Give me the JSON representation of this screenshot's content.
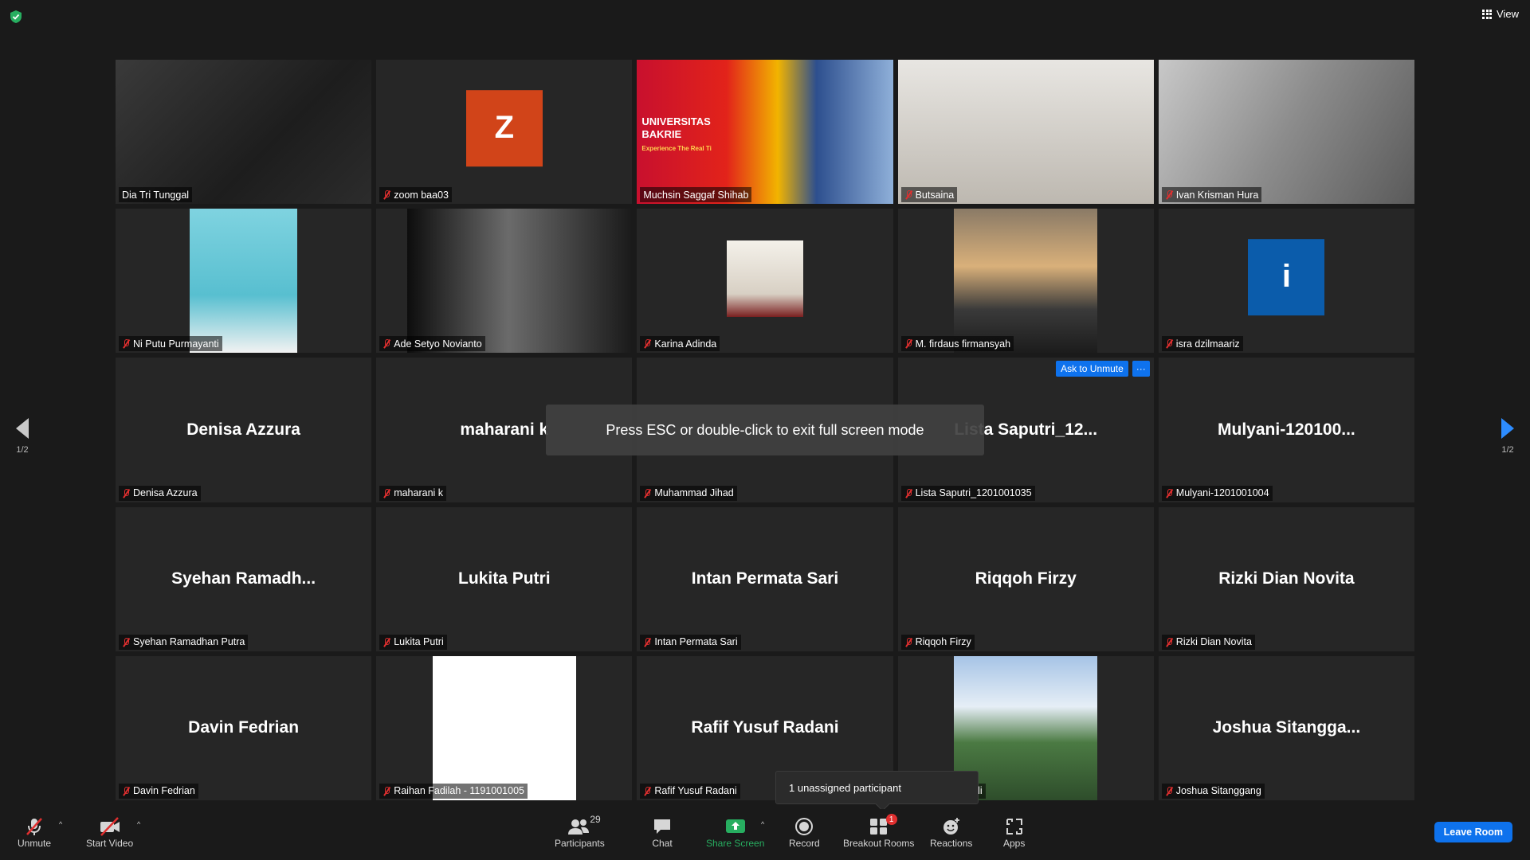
{
  "top_bar": {
    "view_label": "View"
  },
  "toast": {
    "message": "Press ESC or double-click to exit full screen mode"
  },
  "pagination": {
    "left_page": "1/2",
    "right_page": "1/2"
  },
  "ask_to_unmute": {
    "label": "Ask to Unmute",
    "more": "···"
  },
  "popup": {
    "text": "1 unassigned participant"
  },
  "tiles": [
    {
      "label": "Dia Tri Tunggal",
      "display_name": "",
      "video": "video-dark",
      "muted": false,
      "active": true
    },
    {
      "label": "zoom baa03",
      "display_name": "",
      "avatar": "Z",
      "avatar_color": "#d14419",
      "muted": true
    },
    {
      "label": "Muchsin Saggaf Shihab",
      "display_name": "",
      "video": "video-banner",
      "banner_title": "UNIVERSITAS\nBAKRIE",
      "banner_sub": "Experience The Real Ti",
      "muted": false
    },
    {
      "label": "Butsaina",
      "display_name": "",
      "video": "video-warm",
      "muted": true
    },
    {
      "label": "Ivan Krisman Hura",
      "display_name": "",
      "video": "video-grey",
      "muted": true
    },
    {
      "label": "Ni Putu Purmayanti",
      "display_name": "",
      "video": "video-hood",
      "muted": true
    },
    {
      "label": "Ade Setyo Novianto",
      "display_name": "",
      "video": "video-night",
      "muted": true
    },
    {
      "label": "Karina Adinda",
      "display_name": "",
      "video": "video-office",
      "muted": true
    },
    {
      "label": "M. firdaus firmansyah",
      "display_name": "",
      "video": "video-sunset",
      "muted": true
    },
    {
      "label": "isra dzilmaariz",
      "display_name": "",
      "avatar": "i",
      "avatar_color": "#0b5cab",
      "muted": true
    },
    {
      "label": "Denisa Azzura",
      "display_name": "Denisa Azzura",
      "muted": true
    },
    {
      "label": "maharani k",
      "display_name": "maharani k",
      "muted": true
    },
    {
      "label": "Muhammad Jihad",
      "display_name": "",
      "muted": true
    },
    {
      "label": "Lista Saputri_1201001035",
      "display_name": "Lista Saputri_12...",
      "muted": true,
      "ask_unmute": true
    },
    {
      "label": "Mulyani-1201001004",
      "display_name": "Mulyani-120100...",
      "muted": true
    },
    {
      "label": "Syehan Ramadhan Putra",
      "display_name": "Syehan Ramadh...",
      "muted": true
    },
    {
      "label": "Lukita Putri",
      "display_name": "Lukita Putri",
      "muted": true
    },
    {
      "label": "Intan Permata Sari",
      "display_name": "Intan Permata Sari",
      "muted": true
    },
    {
      "label": "Riqqoh Firzy",
      "display_name": "Riqqoh Firzy",
      "muted": true
    },
    {
      "label": "Rizki Dian Novita",
      "display_name": "Rizki Dian Novita",
      "muted": true
    },
    {
      "label": "Davin Fedrian",
      "display_name": "Davin Fedrian",
      "muted": true
    },
    {
      "label": "Raihan Fadilah - 1191001005",
      "display_name": "",
      "video": "video-white",
      "muted": true
    },
    {
      "label": "Rafif Yusuf Radani",
      "display_name": "Rafif Yusuf Radani",
      "muted": true
    },
    {
      "label": "Hilmy Djunaedi",
      "display_name": "",
      "video": "video-landscape",
      "muted": true
    },
    {
      "label": "Joshua Sitanggang",
      "display_name": "Joshua Sitangga...",
      "muted": true
    }
  ],
  "toolbar": {
    "unmute": "Unmute",
    "start_video": "Start Video",
    "participants": "Participants",
    "participants_count": "29",
    "chat": "Chat",
    "share_screen": "Share Screen",
    "record": "Record",
    "breakout_rooms": "Breakout Rooms",
    "breakout_badge": "1",
    "reactions": "Reactions",
    "apps": "Apps",
    "leave": "Leave Room"
  },
  "colors": {
    "accent_blue": "#0e72ed",
    "share_green": "#27ae60",
    "active_speaker": "#d4e157",
    "muted_red": "#e02f2f"
  }
}
